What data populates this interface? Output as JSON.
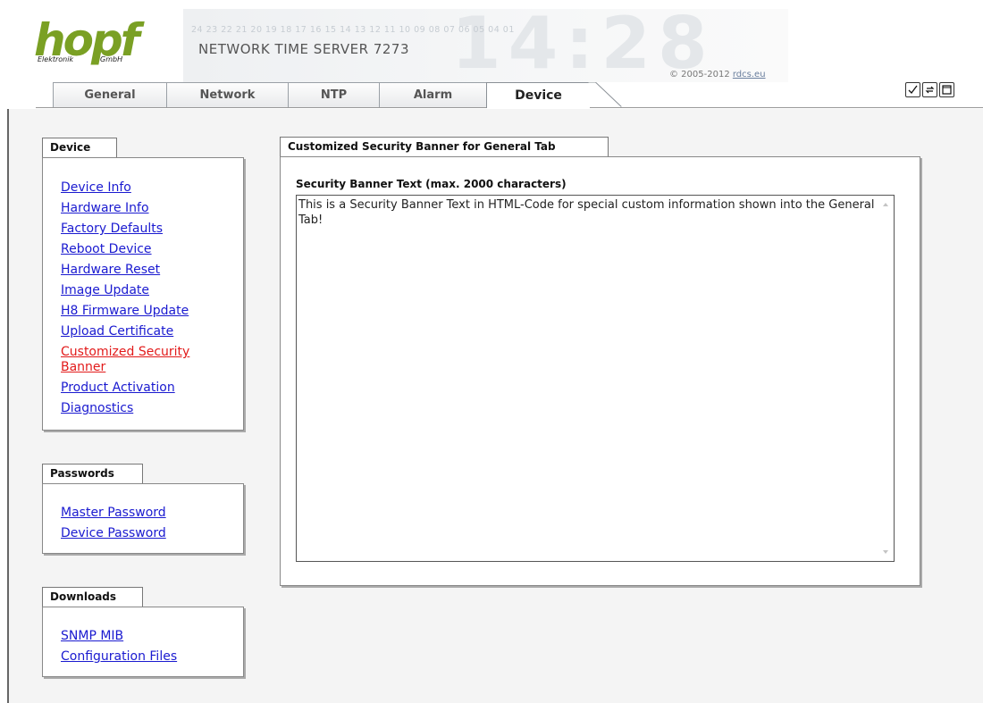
{
  "header": {
    "logo_word": "hopf",
    "logo_sub_left": "Elektronik",
    "logo_sub_right": "GmbH",
    "digits": "24 23 22 21 20 19 18 17 16 15 14 13 12 11 10 09 08 07 06 05 04 01",
    "ghost_time": "14:28",
    "server_title": "NETWORK TIME SERVER 7273",
    "copyright": "© 2005-2012",
    "copyright_link": "rdcs.eu"
  },
  "tabs": [
    {
      "label": "General",
      "active": false
    },
    {
      "label": "Network",
      "active": false
    },
    {
      "label": "NTP",
      "active": false
    },
    {
      "label": "Alarm",
      "active": false
    },
    {
      "label": "Device",
      "active": true
    }
  ],
  "header_icons": [
    "check-icon",
    "refresh-icon",
    "window-icon"
  ],
  "sidebar": {
    "device": {
      "title": "Device",
      "items": [
        {
          "label": "Device Info"
        },
        {
          "label": "Hardware Info"
        },
        {
          "label": "Factory Defaults"
        },
        {
          "label": "Reboot Device"
        },
        {
          "label": "Hardware Reset"
        },
        {
          "label": "Image Update"
        },
        {
          "label": "H8 Firmware Update"
        },
        {
          "label": "Upload Certificate"
        },
        {
          "label": "Customized Security Banner",
          "active": true
        },
        {
          "label": "Product Activation"
        },
        {
          "label": "Diagnostics"
        }
      ]
    },
    "passwords": {
      "title": "Passwords",
      "items": [
        {
          "label": "Master Password"
        },
        {
          "label": "Device Password"
        }
      ]
    },
    "downloads": {
      "title": "Downloads",
      "items": [
        {
          "label": "SNMP MIB"
        },
        {
          "label": "Configuration Files"
        }
      ]
    }
  },
  "main": {
    "title": "Customized Security Banner for General Tab",
    "field_label": "Security Banner Text (max. 2000 characters)",
    "banner_text": "This is a Security Banner Text in HTML-Code for special custom information shown into the General Tab!"
  }
}
